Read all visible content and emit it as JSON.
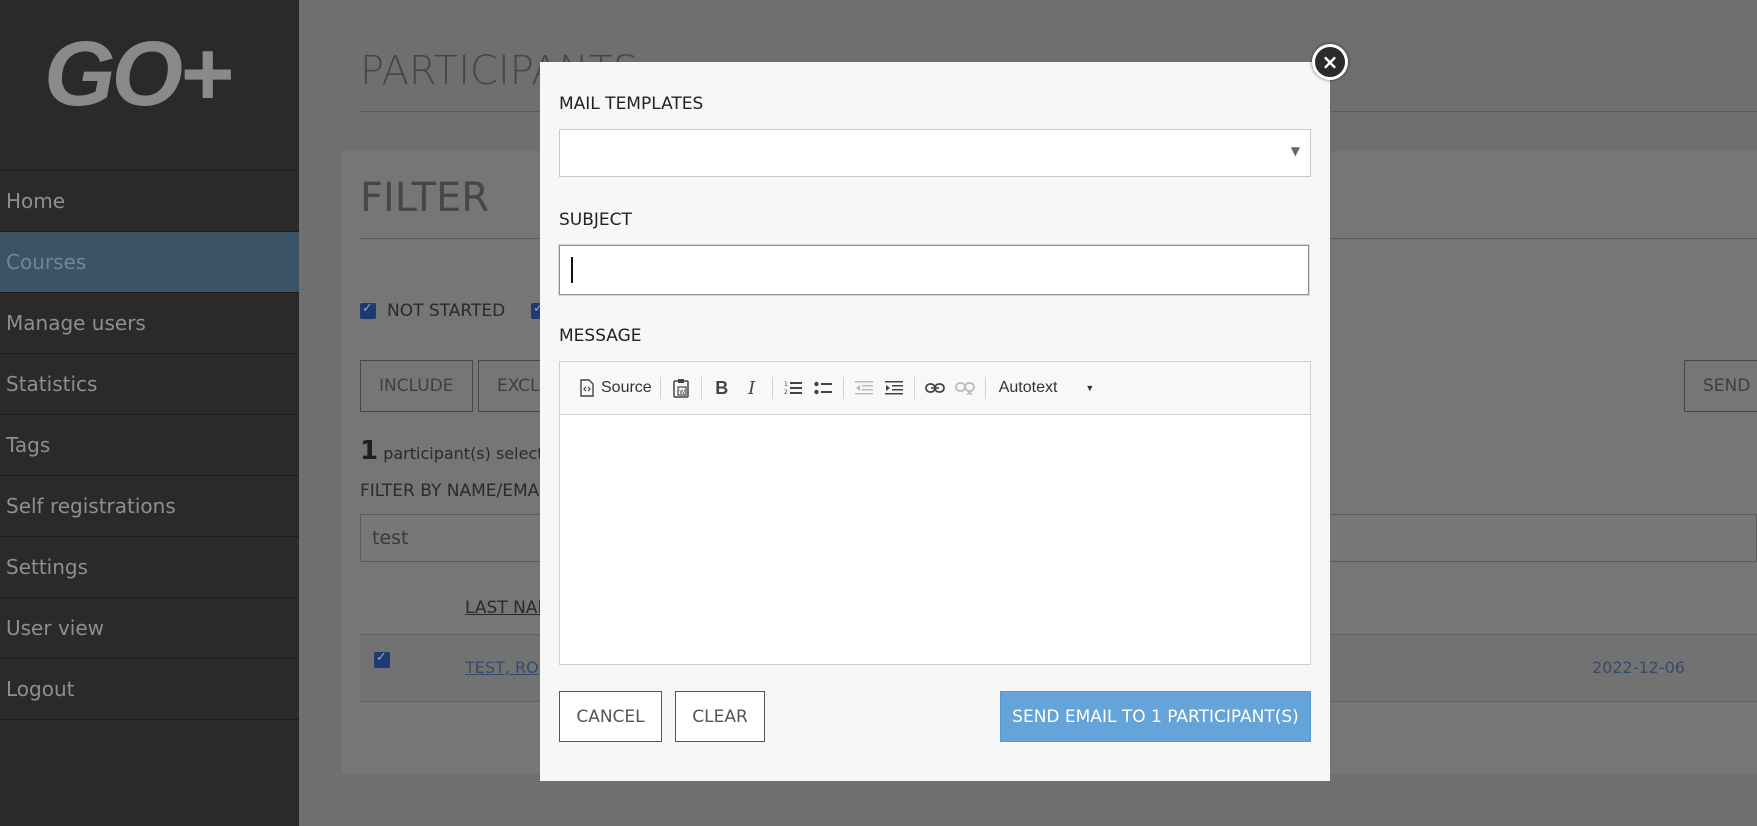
{
  "logo": "GO+",
  "sidebar": {
    "items": [
      {
        "label": "Home"
      },
      {
        "label": "Courses",
        "active": true
      },
      {
        "label": "Manage users"
      },
      {
        "label": "Statistics"
      },
      {
        "label": "Tags"
      },
      {
        "label": "Self registrations"
      },
      {
        "label": "Settings"
      },
      {
        "label": "User view"
      },
      {
        "label": "Logout"
      }
    ]
  },
  "background": {
    "title": "PARTICIPANTS",
    "filter_title": "FILTER",
    "not_started": "NOT STARTED",
    "include": "INCLUDE",
    "exclude": "EXCLUDE",
    "send": "SEND E",
    "selected_count": "1",
    "selected_text": "participant(s) selected",
    "filter_label": "FILTER BY NAME/EMAIL",
    "filter_value": "test",
    "col_last_name": "LAST NAME",
    "row_name": "TEST, RO",
    "row_date": "2022-12-06"
  },
  "modal": {
    "close": "×",
    "mail_templates_label": "MAIL TEMPLATES",
    "mail_templates_value": "",
    "subject_label": "SUBJECT",
    "subject_value": "",
    "message_label": "MESSAGE",
    "toolbar": {
      "source": "Source",
      "autotext": "Autotext"
    },
    "cancel": "CANCEL",
    "clear": "CLEAR",
    "send": "SEND EMAIL TO 1 PARTICIPANT(S)"
  },
  "colors": {
    "accent": "#64a4d8",
    "sidebar_bg": "#2a2a2a",
    "active_nav": "#3c5366"
  }
}
